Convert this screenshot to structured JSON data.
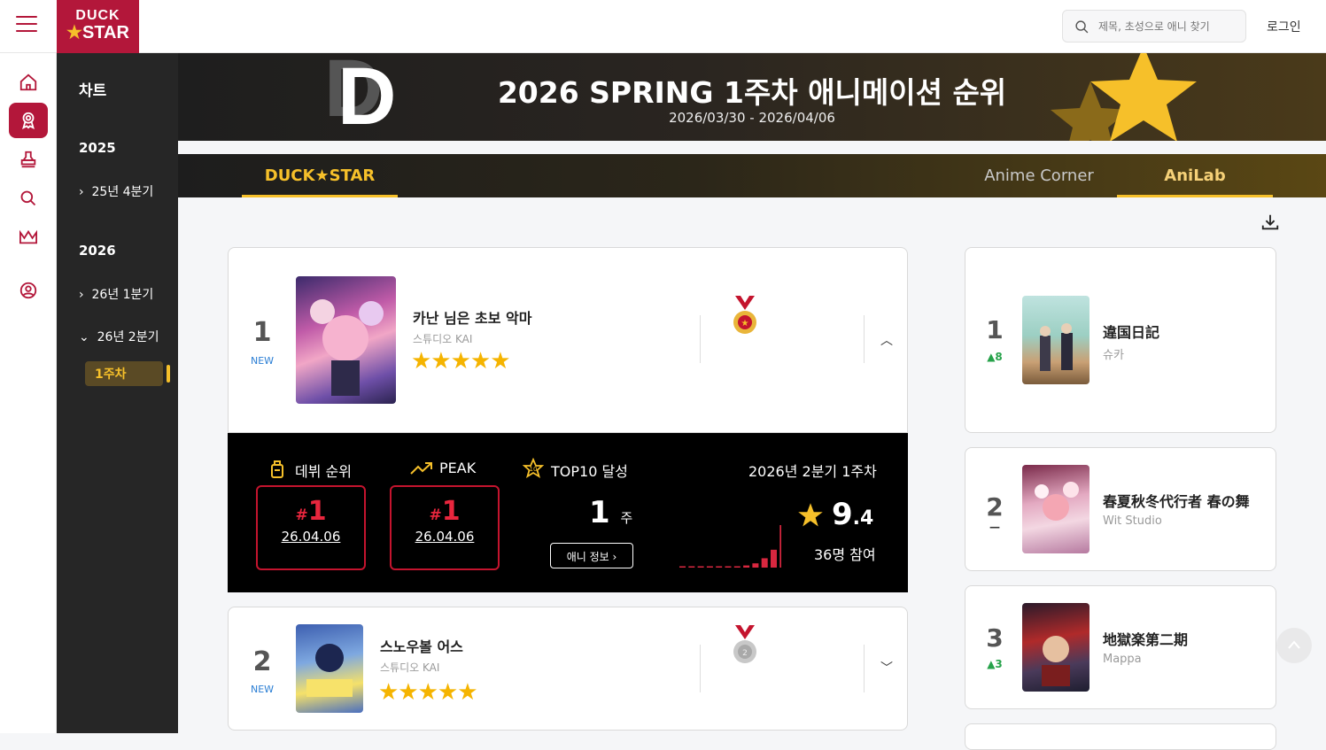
{
  "header": {
    "logo_line1": "DUCK",
    "logo_star": "★",
    "logo_line2": "STAR",
    "search_placeholder": "제목, 초성으로 애니 찾기",
    "login": "로그인"
  },
  "rail": {
    "icons": [
      "home-icon",
      "award-icon",
      "stamp-icon",
      "search-icon",
      "crown-icon",
      "user-icon"
    ],
    "active_index": 1
  },
  "sidebar": {
    "title": "차트",
    "year1": "2025",
    "item_2025_q4": "25년 4분기",
    "year2": "2026",
    "item_2026_q1": "26년 1분기",
    "item_2026_q2": "26년 2분기",
    "week": "1주차"
  },
  "hero": {
    "logo_letter": "D",
    "title": "2026 SPRING 1주차 애니메이션 순위",
    "date_range": "2026/03/30 - 2026/04/06"
  },
  "tabs": {
    "duckstar": "DUCK★STAR",
    "anime_corner": "Anime Corner",
    "anilab": "AniLab"
  },
  "main_list": [
    {
      "rank": "1",
      "change": "NEW",
      "title": "카난 님은 초보 악마",
      "studio": "스튜디오 KAI",
      "stars": "★★★★★",
      "medal": "gold"
    },
    {
      "rank": "2",
      "change": "NEW",
      "title": "스노우볼 어스",
      "studio": "스튜디오 KAI",
      "stars": "★★★★★",
      "medal": "silver"
    }
  ],
  "detail": {
    "debut_label": "데뷔 순위",
    "peak_label": "PEAK",
    "top10_label": "TOP10 달성",
    "debut_rank": "1",
    "debut_hash": "#",
    "debut_date": "26.04.06",
    "peak_rank": "1",
    "peak_hash": "#",
    "peak_date": "26.04.06",
    "top10_weeks": "1",
    "top10_unit": "주",
    "info_button": "애니 정보",
    "season_week": "2026년 2분기 1주차",
    "score_int": "9",
    "score_dec": ".4",
    "votes": "36명 참여",
    "vote_bars": [
      0.02,
      0.02,
      0.02,
      0.02,
      0.02,
      0.02,
      0.03,
      0.05,
      0.1,
      0.22,
      0.42,
      1.0
    ]
  },
  "side_list": [
    {
      "rank": "1",
      "change": "▲8",
      "title": "違国日記",
      "studio": "슈카"
    },
    {
      "rank": "2",
      "change": "—",
      "title": "春夏秋冬代行者 春の舞",
      "studio": "Wit Studio"
    },
    {
      "rank": "3",
      "change": "▲3",
      "title": "地獄楽第二期",
      "studio": "Mappa"
    }
  ],
  "colors": {
    "brand": "#b3173a",
    "accent": "#f6c02a",
    "rank_up": "#26a24a",
    "new": "#2a7ed4"
  }
}
